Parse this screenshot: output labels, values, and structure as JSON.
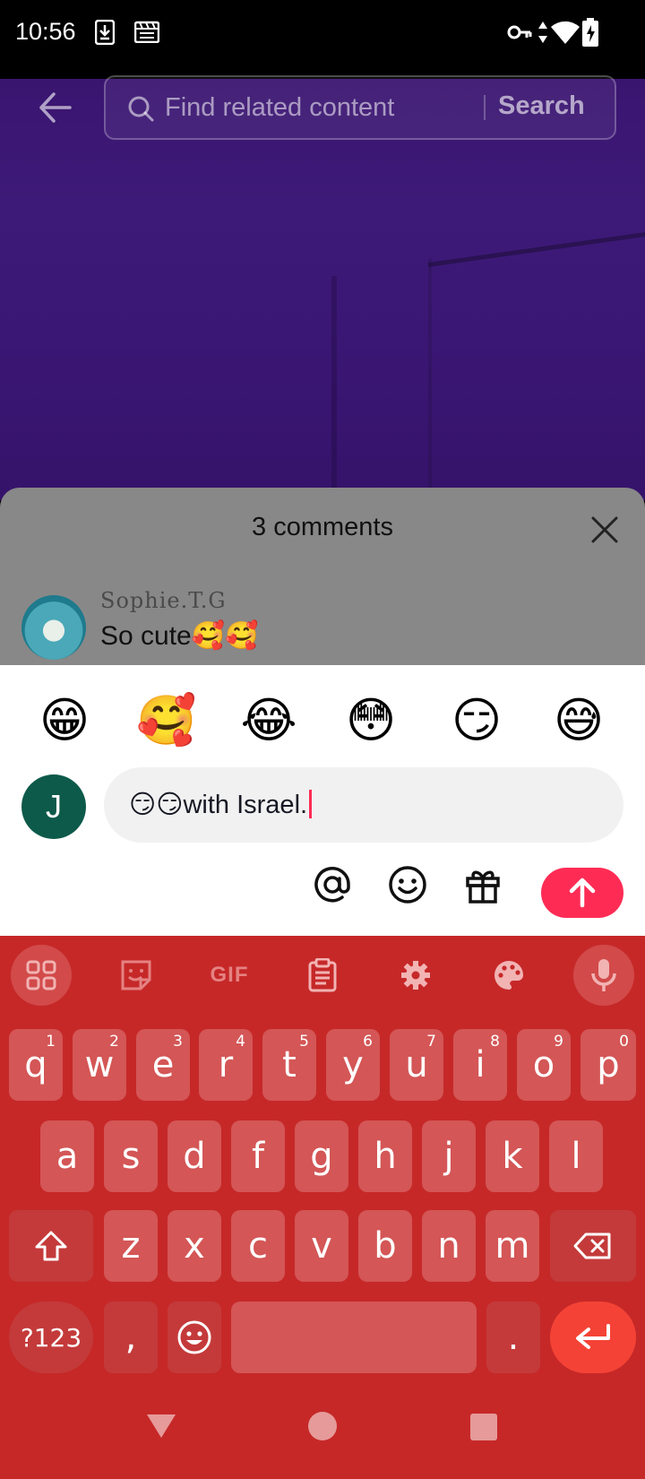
{
  "status_bar": {
    "time": "10:56"
  },
  "search": {
    "placeholder": "Find related content",
    "button": "Search"
  },
  "comments": {
    "title": "3 comments",
    "items": [
      {
        "user": "Sophie.T.G",
        "text": "So cute🥰🥰"
      }
    ]
  },
  "composer": {
    "quick_emojis": [
      "😁",
      "🥰",
      "😂",
      "😳",
      "😏",
      "😅"
    ],
    "avatar_initial": "J",
    "text": "😏😏with Israel."
  },
  "keyboard": {
    "gif_label": "GIF",
    "row1": [
      {
        "k": "q",
        "s": "1"
      },
      {
        "k": "w",
        "s": "2"
      },
      {
        "k": "e",
        "s": "3"
      },
      {
        "k": "r",
        "s": "4"
      },
      {
        "k": "t",
        "s": "5"
      },
      {
        "k": "y",
        "s": "6"
      },
      {
        "k": "u",
        "s": "7"
      },
      {
        "k": "i",
        "s": "8"
      },
      {
        "k": "o",
        "s": "9"
      },
      {
        "k": "p",
        "s": "0"
      }
    ],
    "row2": [
      "a",
      "s",
      "d",
      "f",
      "g",
      "h",
      "j",
      "k",
      "l"
    ],
    "row3": [
      "z",
      "x",
      "c",
      "v",
      "b",
      "n",
      "m"
    ],
    "symbols_label": "?123",
    "comma": ",",
    "period": "."
  },
  "colors": {
    "accent": "#fe2c55",
    "keyboard_bg": "#c62828"
  }
}
